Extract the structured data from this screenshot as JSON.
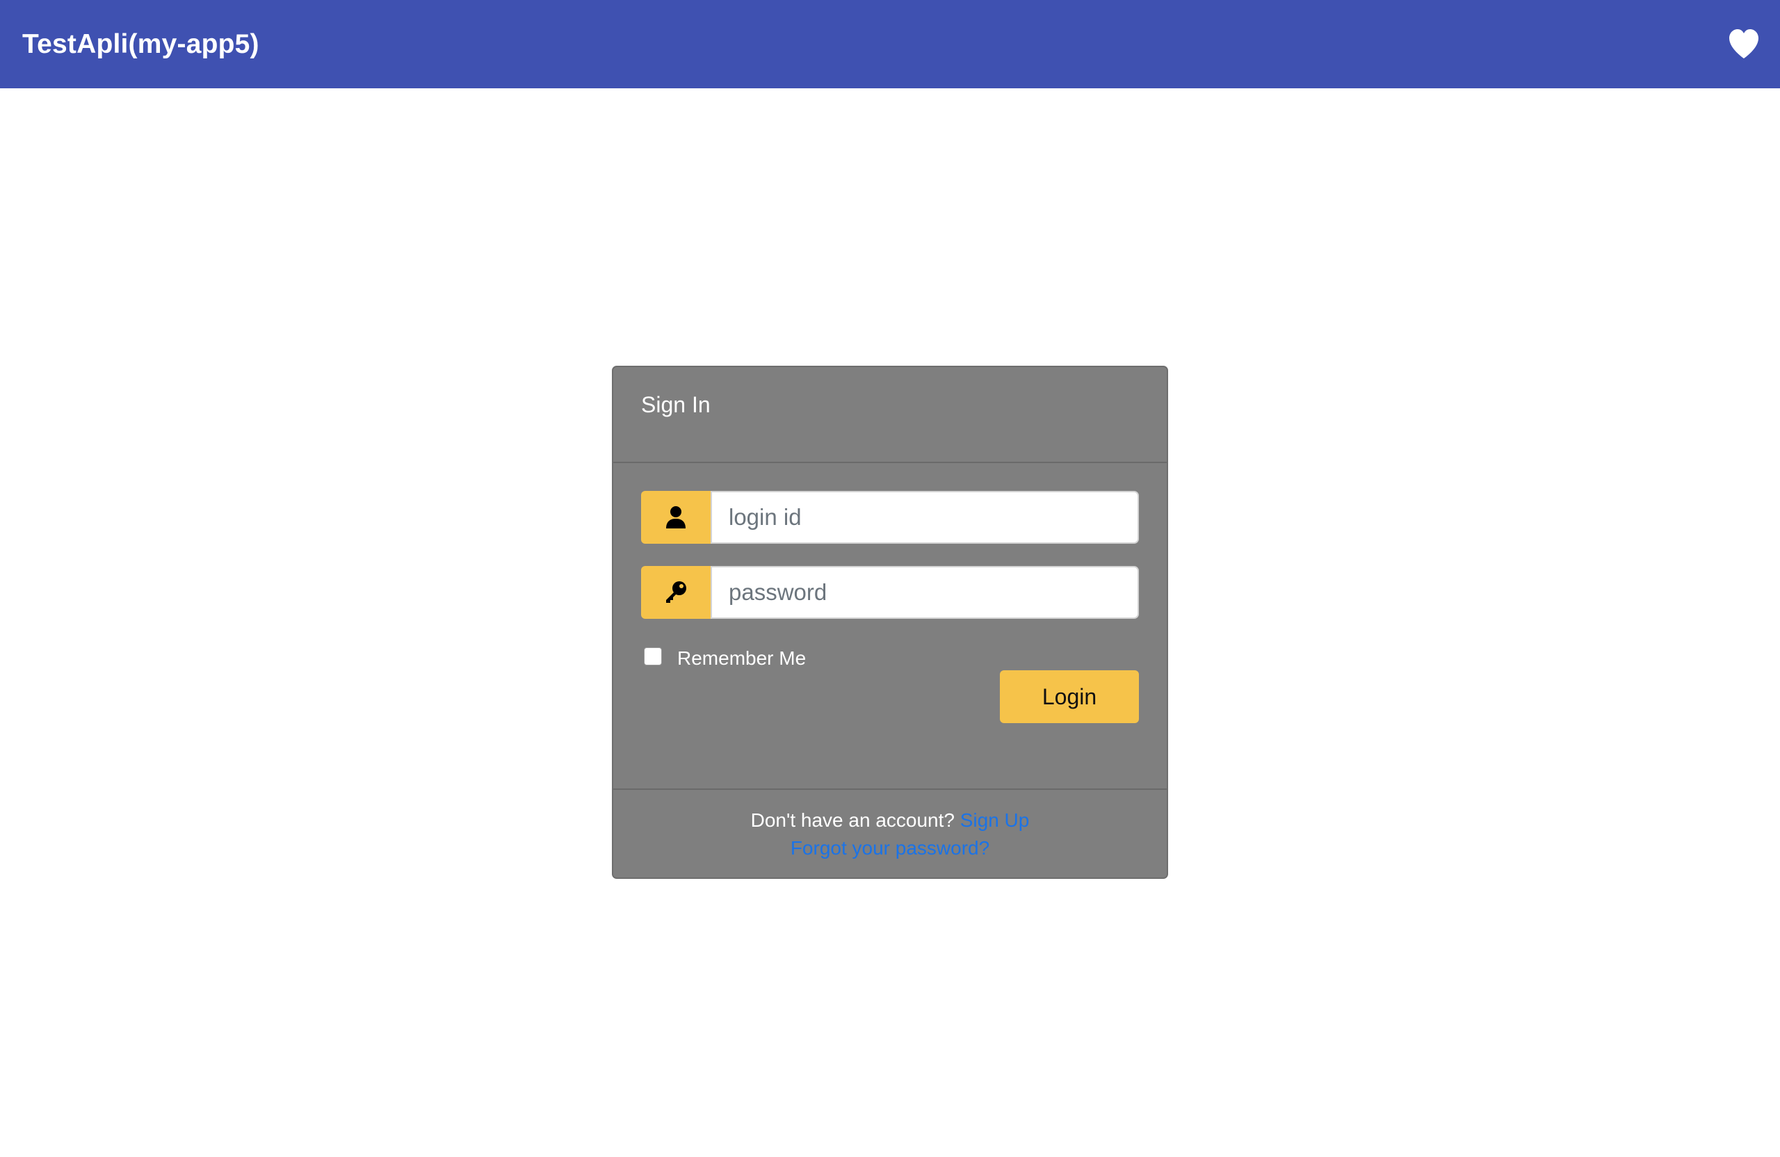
{
  "app": {
    "title": "TestApli(my-app5)",
    "favorite_icon": "heart-icon",
    "header_color": "#3f51b1"
  },
  "signin": {
    "title": "Sign In",
    "login_id": {
      "placeholder": "login id",
      "value": "",
      "icon": "user-icon"
    },
    "password": {
      "placeholder": "password",
      "value": "",
      "icon": "key-icon"
    },
    "remember_label": "Remember Me",
    "remember_checked": false,
    "login_label": "Login",
    "accent_color": "#f6c34a",
    "card_color": "#7f7f7f"
  },
  "footer": {
    "no_account_text": "Don't have an account?",
    "signup_label": "Sign Up",
    "forgot_label": "Forgot your password?",
    "link_color": "#1a73e8"
  }
}
